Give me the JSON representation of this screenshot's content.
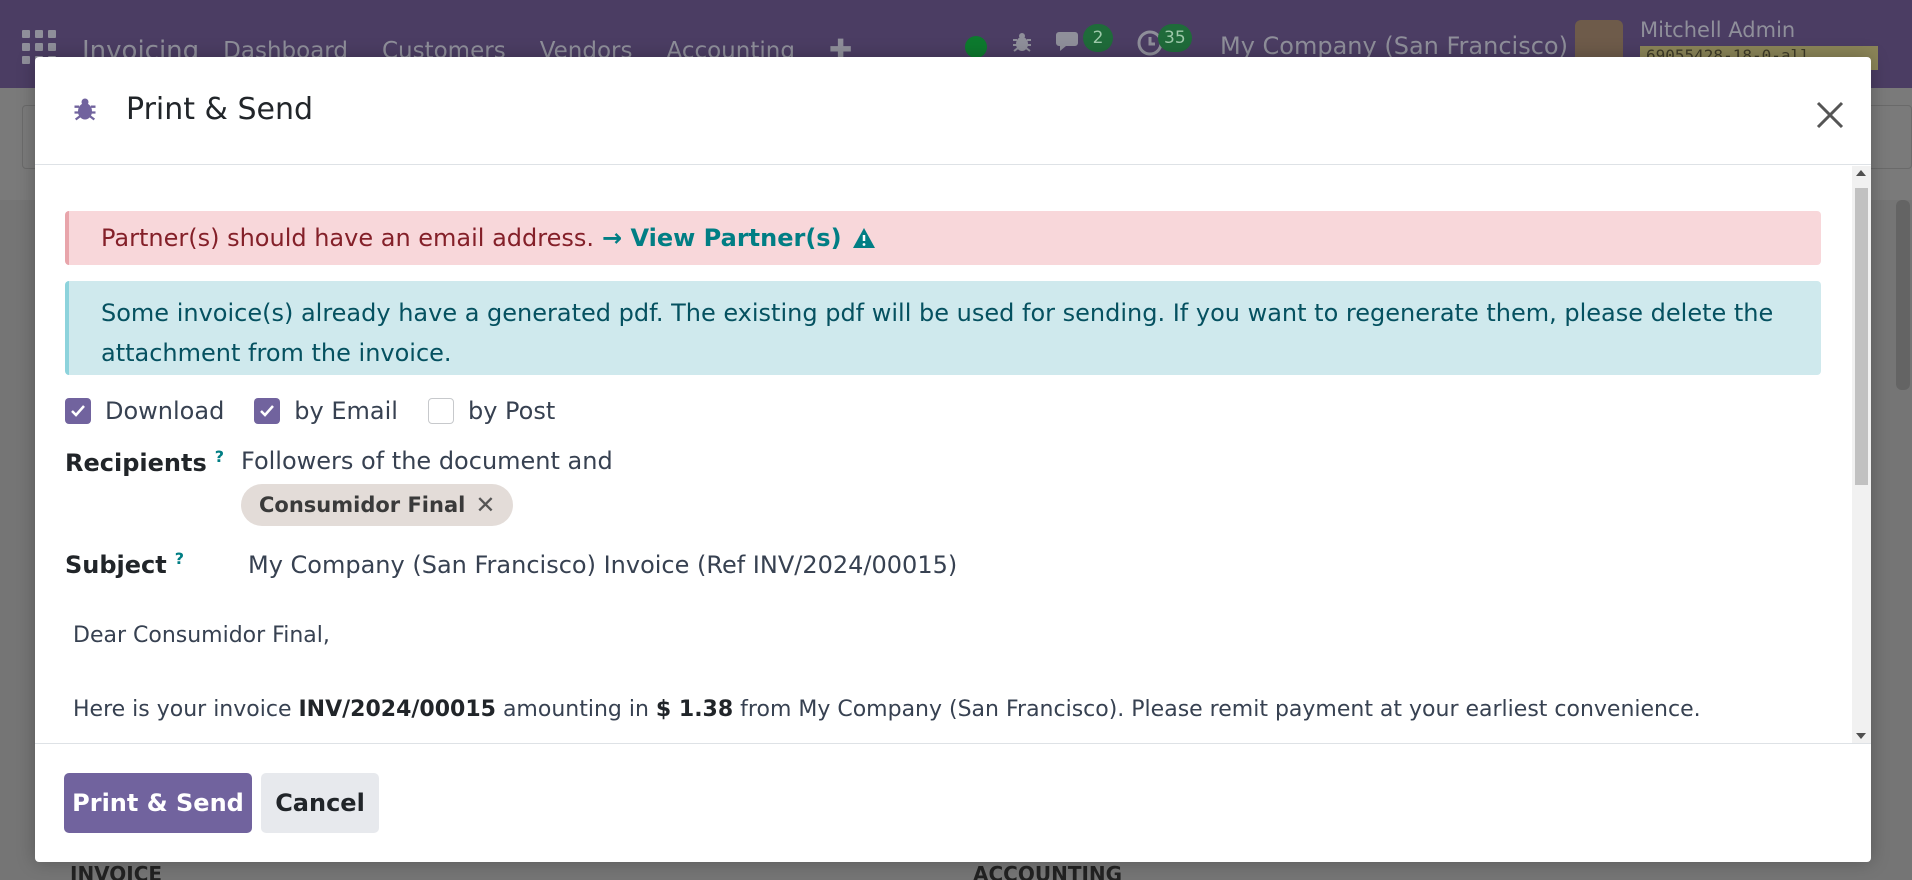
{
  "app": {
    "brand": "Invoicing",
    "menu": [
      "Dashboard",
      "Customers",
      "Vendors",
      "Accounting"
    ],
    "messages_count": "2",
    "activities_count": "35",
    "company": "My Company (San Francisco)",
    "user_name": "Mitchell Admin",
    "db_name": "69055428-18-0-all"
  },
  "background": {
    "col_left": "INVOICE",
    "col_right": "ACCOUNTING"
  },
  "modal": {
    "title": "Print & Send",
    "alert_danger": {
      "text": "Partner(s) should have an email address.",
      "link": "→ View Partner(s)"
    },
    "alert_info": {
      "line1": "Some invoice(s) already have a generated pdf. The existing pdf will be used for sending. If you want to regenerate them, please delete the",
      "line2": "attachment from the invoice."
    },
    "options": [
      {
        "label": "Download",
        "checked": true
      },
      {
        "label": "by Email",
        "checked": true
      },
      {
        "label": "by Post",
        "checked": false
      }
    ],
    "recipients": {
      "label": "Recipients",
      "help": "?",
      "text": "Followers of the document and",
      "tag": "Consumidor Final"
    },
    "subject": {
      "label": "Subject",
      "help": "?",
      "value": "My Company (San Francisco) Invoice (Ref INV/2024/00015)"
    },
    "email": {
      "greeting": "Dear Consumidor Final,",
      "p1_a": "Here is your invoice",
      "p1_invoice": "INV/2024/00015",
      "p1_b": "amounting in",
      "p1_amount": "$ 1.38",
      "p1_c": "from My Company (San Francisco). Please remit payment at your earliest convenience."
    },
    "buttons": {
      "primary": "Print & Send",
      "cancel": "Cancel"
    }
  },
  "colors": {
    "primary": "#71639e",
    "link": "#017e84",
    "danger_bg": "#f8d7da",
    "info_bg": "#cfe9ed"
  }
}
